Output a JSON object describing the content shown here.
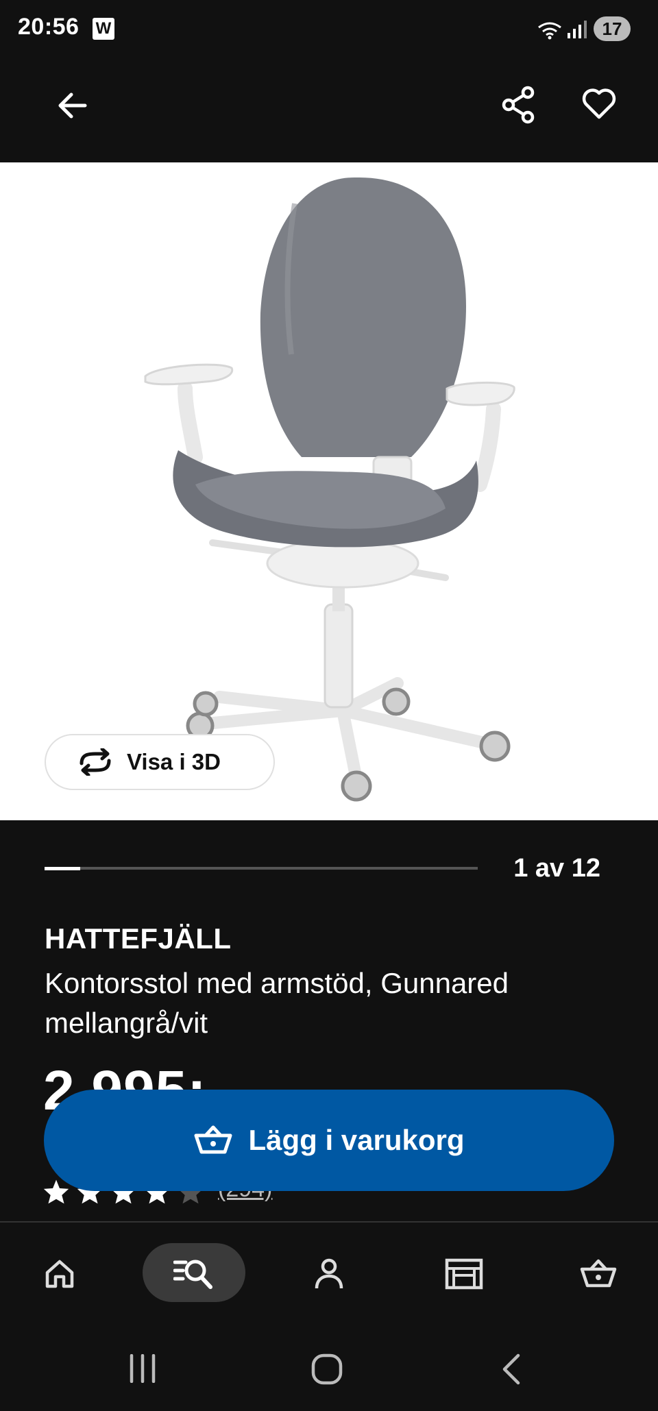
{
  "status_bar": {
    "time": "20:56",
    "notification_badge": "W",
    "battery": "17"
  },
  "app_bar": {
    "back_icon": "arrow-left-icon",
    "share_icon": "share-icon",
    "favorite_icon": "heart-icon"
  },
  "gallery": {
    "view_3d_label": "Visa i 3D",
    "counter": "1 av 12",
    "progress_fraction": 0.083
  },
  "product": {
    "brand": "HATTEFJÄLL",
    "description": "Kontorsstol med armstöd, Gunnared mellangrå/vit",
    "price": "2 995:-",
    "rating": 4,
    "rating_max": 5,
    "review_count": "(294)"
  },
  "cta": {
    "label": "Lägg i varukorg",
    "color": "#0058a3"
  },
  "bottom_nav": [
    {
      "name": "home",
      "icon": "home-icon"
    },
    {
      "name": "search",
      "icon": "search-list-icon",
      "active": true
    },
    {
      "name": "profile",
      "icon": "person-icon"
    },
    {
      "name": "stores",
      "icon": "store-icon"
    },
    {
      "name": "cart",
      "icon": "basket-icon"
    }
  ]
}
